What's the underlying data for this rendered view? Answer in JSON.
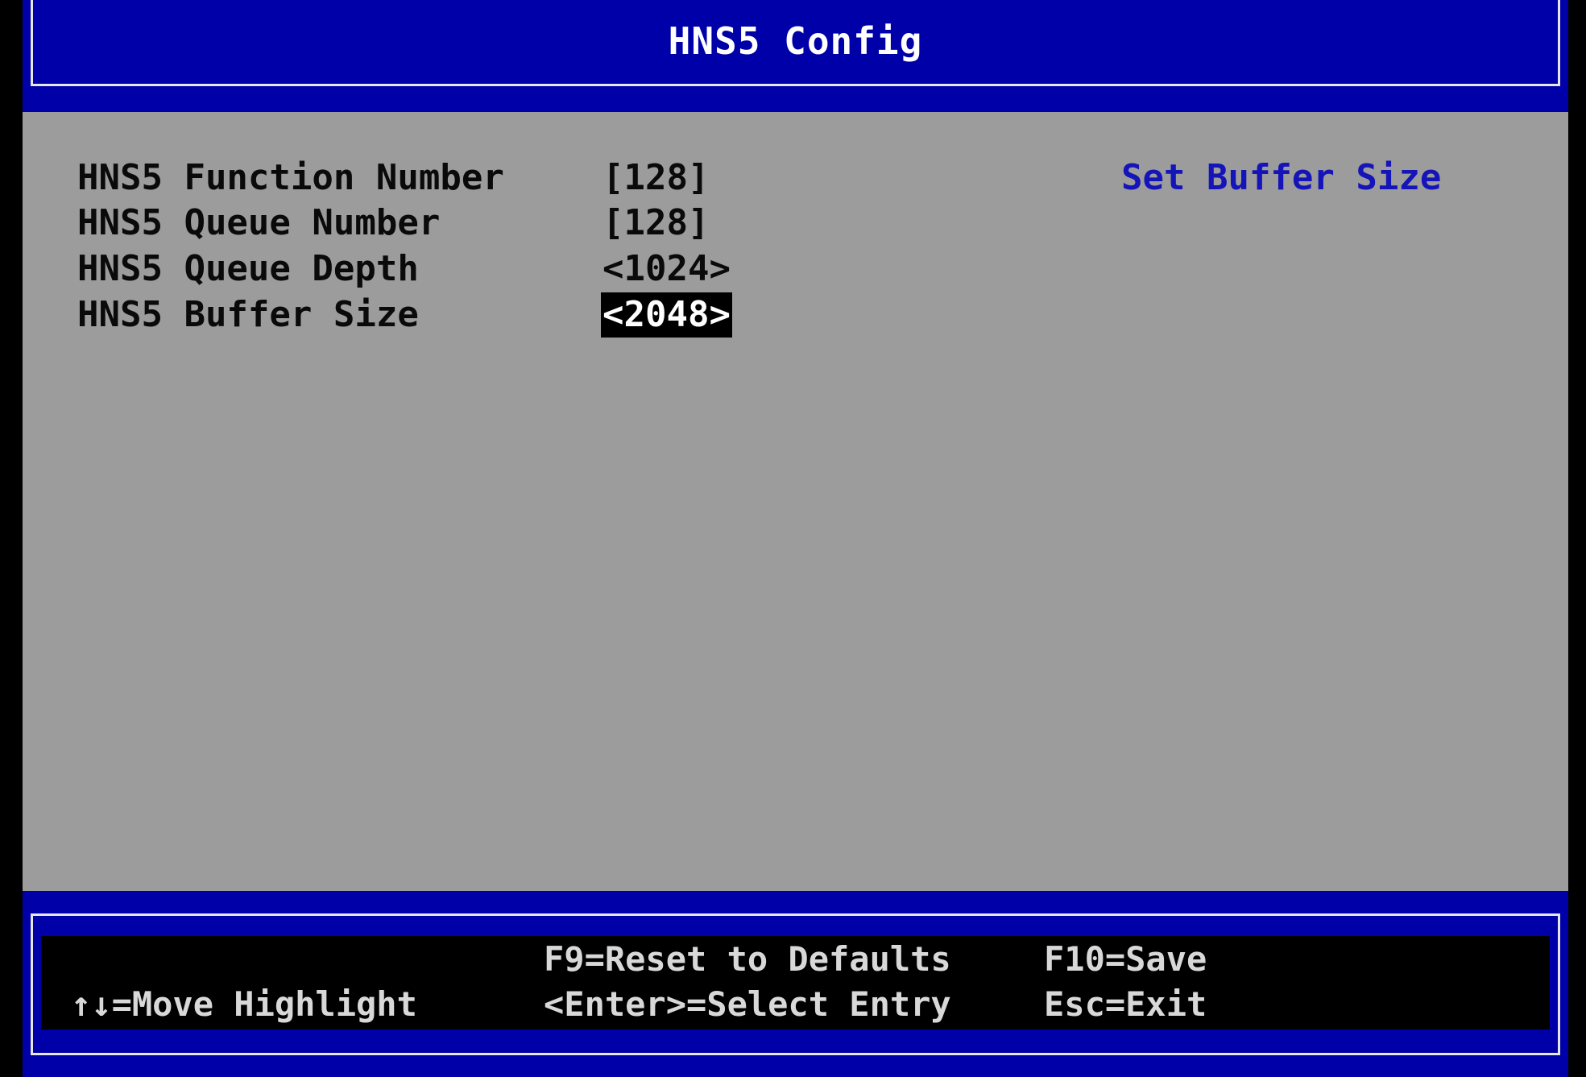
{
  "header": {
    "title": "HNS5 Config"
  },
  "settings": [
    {
      "label": "HNS5 Function Number",
      "value": "[128]"
    },
    {
      "label": "HNS5 Queue Number",
      "value": "[128]"
    },
    {
      "label": "HNS5 Queue Depth",
      "value": "<1024>"
    },
    {
      "label": "HNS5 Buffer Size",
      "value": "<2048>",
      "selected": true
    }
  ],
  "help": {
    "text": "Set Buffer Size"
  },
  "footer": {
    "move_highlight": "↑↓=Move Highlight",
    "reset_defaults": "F9=Reset to Defaults",
    "select_entry": "<Enter>=Select Entry",
    "save": "F10=Save",
    "exit": "Esc=Exit"
  },
  "colors": {
    "frame_blue": "#0000a8",
    "content_gray": "#9c9c9c",
    "help_blue": "#1414b8",
    "selected_bg": "#000000"
  }
}
